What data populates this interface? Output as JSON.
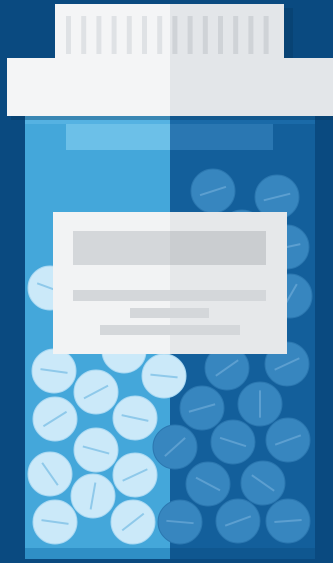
{
  "illustration": {
    "subject": "pill-bottle",
    "colors": {
      "background": "#0a4a80",
      "cap_light": "#f4f5f6",
      "cap_shade": "#e3e6e9",
      "cap_ridge": "#cfd3d7",
      "bottle_left": "#44a7da",
      "bottle_right": "#135f9b",
      "pill_left": "#cbe9f9",
      "pill_right": "#3786bf",
      "label_light": "#f2f3f4",
      "label_shade": "#e6e8ea",
      "label_bar": "#d4d7da"
    }
  }
}
